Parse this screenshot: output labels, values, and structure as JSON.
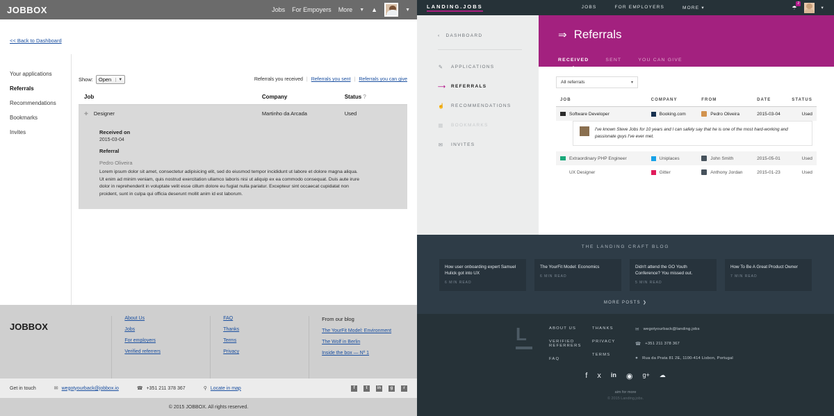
{
  "left": {
    "header": {
      "logo": "JOBBOX",
      "nav": [
        "Jobs",
        "For Empoyers",
        "More"
      ],
      "caret": "chevron-down-icon",
      "bell": "bell-icon",
      "avatar": "user-avatar"
    },
    "back_link": "<< Back to Dashboard",
    "sidebar": [
      {
        "label": "Your applications",
        "selected": false
      },
      {
        "label": "Referrals",
        "selected": true
      },
      {
        "label": "Recommendations",
        "selected": false
      },
      {
        "label": "Bookmarks",
        "selected": false
      },
      {
        "label": "Invites",
        "selected": false
      }
    ],
    "toolbar": {
      "show_label": "Show:",
      "select_value": "Open",
      "links": [
        {
          "label": "Referrals you received",
          "link": false
        },
        {
          "label": "Referrals you sent",
          "link": true
        },
        {
          "label": "Referrals you can give",
          "link": true
        }
      ]
    },
    "table": {
      "headers": [
        "Job",
        "Company",
        "Status"
      ],
      "status_help": "?",
      "row": {
        "job": "Designer",
        "company": "Martinho da Arcada",
        "status": "Used"
      }
    },
    "detail": {
      "received_label": "Received on",
      "received_date": "2015-03-04",
      "referral_label": "Referral",
      "referrer": "Pedro Oliveira",
      "body": "Lorem ipsum dolor sit amet, consectetur adipisicing elit, sed do eiusmod tempor incididunt ut labore et dolore magna aliqua. Ut enim ad minim veniam, quis nostrud exercitation ullamco laboris nisi ut aliquip ex ea commodo consequat. Duis aute irure dolor in reprehenderit in voluptate velit esse cillum dolore eu fugiat nulla pariatur. Excepteur sint occaecat cupidatat non proident, sunt in culpa qui officia deserunt mollit anim id est laborum."
    },
    "footer": {
      "logo": "JOBBOX",
      "col1": [
        "About Us",
        "Jobs",
        "For employers",
        "Verified referrers"
      ],
      "col2": [
        "FAQ",
        "Thanks",
        "Terms",
        "Privacy"
      ],
      "blog_heading": "From our blog",
      "blog_links": [
        "The YourFit Model: Environment",
        "The Wolf in Berlin",
        "Inside the box — Nº 1"
      ],
      "get_in_touch": "Get in touch",
      "email": "wegotyourback@jobbox.io",
      "phone": "+351 211 378 367",
      "map": "Locate in map",
      "social": [
        "f",
        "t",
        "in",
        "g",
        "r"
      ],
      "copyright": "© 2015 JOBBOX. All rights reserved."
    }
  },
  "right": {
    "header": {
      "logo": "LANDING.JOBS",
      "nav": [
        "JOBS",
        "FOR EMPLOYERS",
        "MORE"
      ],
      "more_caret": "chevron-down-icon",
      "bell": "bell-icon",
      "badge": "2",
      "avatar": "user-avatar",
      "avatar_caret": "chevron-down-icon"
    },
    "sidebar": {
      "dashboard": "DASHBOARD",
      "back_caret": "chevron-left-icon",
      "items": [
        {
          "label": "APPLICATIONS",
          "icon": "document-check-icon",
          "state": "normal"
        },
        {
          "label": "REFERRALS",
          "icon": "arrow-right-icon",
          "state": "selected"
        },
        {
          "label": "RECOMMENDATIONS",
          "icon": "thumbs-up-icon",
          "state": "normal"
        },
        {
          "label": "BOOKMARKS",
          "icon": "bookmark-icon",
          "state": "disabled"
        },
        {
          "label": "INVITES",
          "icon": "envelope-icon",
          "state": "normal"
        }
      ]
    },
    "hero": {
      "title": "Referrals",
      "icon": "arrow-right-icon",
      "tabs": [
        {
          "label": "RECEIVED",
          "active": true
        },
        {
          "label": "SENT",
          "active": false
        },
        {
          "label": "YOU CAN GIVE",
          "active": false
        }
      ]
    },
    "filter": {
      "value": "All referrals",
      "caret": "chevron-down-icon"
    },
    "table": {
      "headers": [
        "JOB",
        "COMPANY",
        "FROM",
        "DATE",
        "STATUS"
      ],
      "rows": [
        {
          "job": "Software Developer",
          "job_icon": "chat-dark-icon",
          "company": "Booking.com",
          "company_color": "#17314f",
          "from": "Pedro Oliveira",
          "from_icon": "avatar-orange-icon",
          "date": "2015-03-04",
          "status": "Used",
          "note": "I've known Steve Jobs for 10 years and I can safely say that he is one of the most hard-working and passionate guys I've ever met."
        },
        {
          "job": "Extraordinary PHP Engineer",
          "job_icon": "chat-green-icon",
          "company": "Uniplaces",
          "company_color": "#17a2e8",
          "from": "John Smith",
          "from_icon": "avatar-icon",
          "date": "2015-05-01",
          "status": "Used",
          "note": ""
        },
        {
          "job": "UX Designer",
          "job_icon": "",
          "company": "Gitter",
          "company_color": "#e01b5b",
          "from": "Anthony Jordan",
          "from_icon": "avatar-icon",
          "date": "2015-01-23",
          "status": "Used",
          "note": ""
        }
      ]
    },
    "blog": {
      "heading": "THE LANDING CRAFT BLOG",
      "cards": [
        {
          "title": "How user onboarding expert Samuel Hulick got into UX",
          "meta": "6 MIN READ"
        },
        {
          "title": "The YourFit Model: Economics",
          "meta": "6 MIN READ"
        },
        {
          "title": "Didn't attend the GO Youth Conference? You missed out.",
          "meta": "5 MIN READ"
        },
        {
          "title": "How To Be A Great Product Owner",
          "meta": "7 MIN READ"
        }
      ],
      "more": "MORE POSTS",
      "more_caret": "chevron-right-icon"
    },
    "footer": {
      "col1": [
        "ABOUT US",
        "VERIFIED REFERRERS",
        "FAQ"
      ],
      "col2": [
        "THANKS",
        "PRIVACY",
        "TERMS"
      ],
      "email": "wegotyourback@landing.jobs",
      "phone": "+351 211 378 367",
      "address": "Rua da Prata 81 2E, 1100-414 Lisbon, Portugal",
      "social": [
        "facebook-icon",
        "twitter-icon",
        "linkedin-icon",
        "github-icon",
        "googleplus-icon",
        "rss-icon"
      ],
      "tagline": "aim for more",
      "copyright": "© 2015 Landing.jobs."
    }
  },
  "colors": {
    "magenta": "#a3217f",
    "dark_navy": "#263238",
    "slate": "#2e3c47",
    "left_gray": "#6b6b6b",
    "link_blue": "#1a4fa0"
  }
}
